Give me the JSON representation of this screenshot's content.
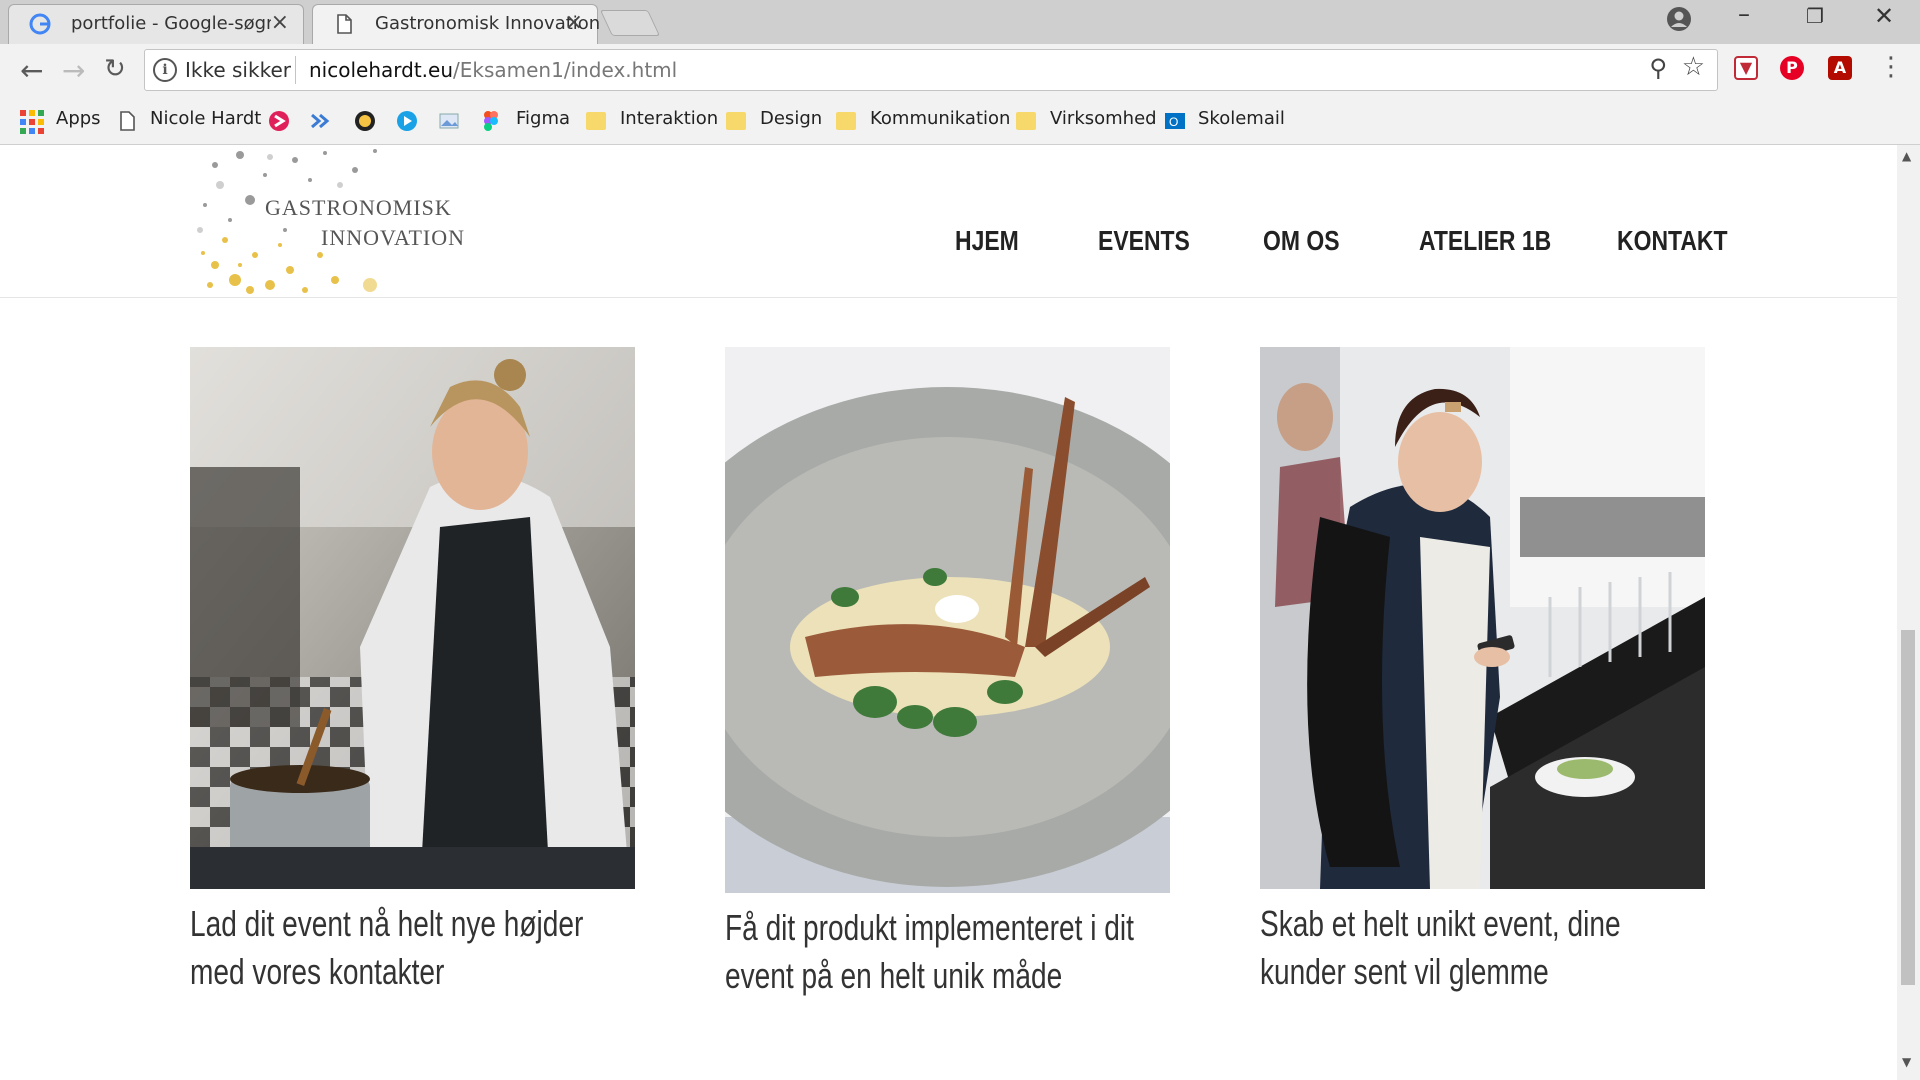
{
  "browser": {
    "tabs": [
      {
        "title": "portfolie - Google-søgning",
        "active": false
      },
      {
        "title": "Gastronomisk Innovation",
        "active": true
      }
    ],
    "security_label": "Ikke sikker",
    "url_host": "nicolehardt.eu",
    "url_path": "/Eksamen1/index.html",
    "bookmarks": {
      "apps": "Apps",
      "nicole": "Nicole Hardt",
      "figma": "Figma",
      "interaktion": "Interaktion",
      "design": "Design",
      "kommunikation": "Kommunikation",
      "virksomhed": "Virksomhed",
      "skolemail": "Skolemail"
    }
  },
  "site": {
    "logo_line1": "GASTRONOMISK",
    "logo_line2": "INNOVATION",
    "nav": {
      "hjem": "HJEM",
      "events": "EVENTS",
      "om_os": "OM OS",
      "atelier": "ATELIER 1B",
      "kontakt": "KONTAKT"
    },
    "cards": [
      {
        "caption": "Lad dit event nå helt nye højder med vores kontakter"
      },
      {
        "caption": "Få dit produkt implementeret i dit event på en helt unik måde"
      },
      {
        "caption": "Skab et helt unikt event, dine kunder sent vil glemme"
      }
    ]
  },
  "colors": {
    "accent_gold": "#e8c14a",
    "nav_text": "#222222",
    "caption_text": "#333333"
  }
}
